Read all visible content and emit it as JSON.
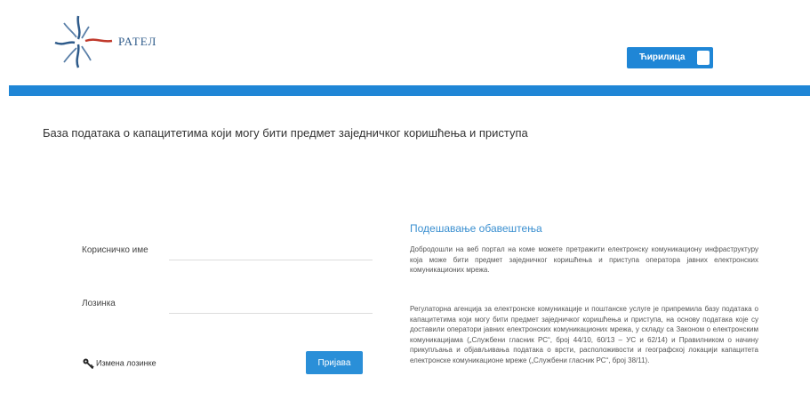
{
  "header": {
    "logo_text": "РАТЕЛ",
    "logo_subtitle": "",
    "language_toggle_label": "Ћирилица"
  },
  "page": {
    "title": "База података о капацитетима који могу бити предмет заједничког коришћења и приступа"
  },
  "login_form": {
    "username_label": "Корисничко име",
    "password_label": "Лозинка",
    "username_value": "",
    "password_value": "",
    "forgot_password_label": "Измена лозинке",
    "login_button_label": "Пријава"
  },
  "info": {
    "title": "Подешавање обавештења",
    "paragraph1": "Добродошли на веб портал на коме можете претражити електронску комуникациону инфраструктуру која може бити предмет заједничког коришћења и приступа оператора јавних електронских комуникационих мрежа.",
    "paragraph2": "Регулаторна агенција за електронске комуникације и поштанске услуге је припремила базу података о капацитетима који могу бити предмет заједничког коришћења и приступа, на основу података које су доставили оператори јавних електронских комуникационих мрежа, у складу са Законом о електронским комуникацијама („Службени гласник РС“, број 44/10, 60/13 – УС и 62/14) и Правилником о начину прикупљања и објављивања података о врсти, расположивости и географској локацији капацитета електронске комуникационе мреже („Службени гласник РС“, број 38/11)."
  },
  "colors": {
    "accent": "#1f86d6",
    "button": "#2a8fd8",
    "info_title": "#3a8fd0"
  }
}
